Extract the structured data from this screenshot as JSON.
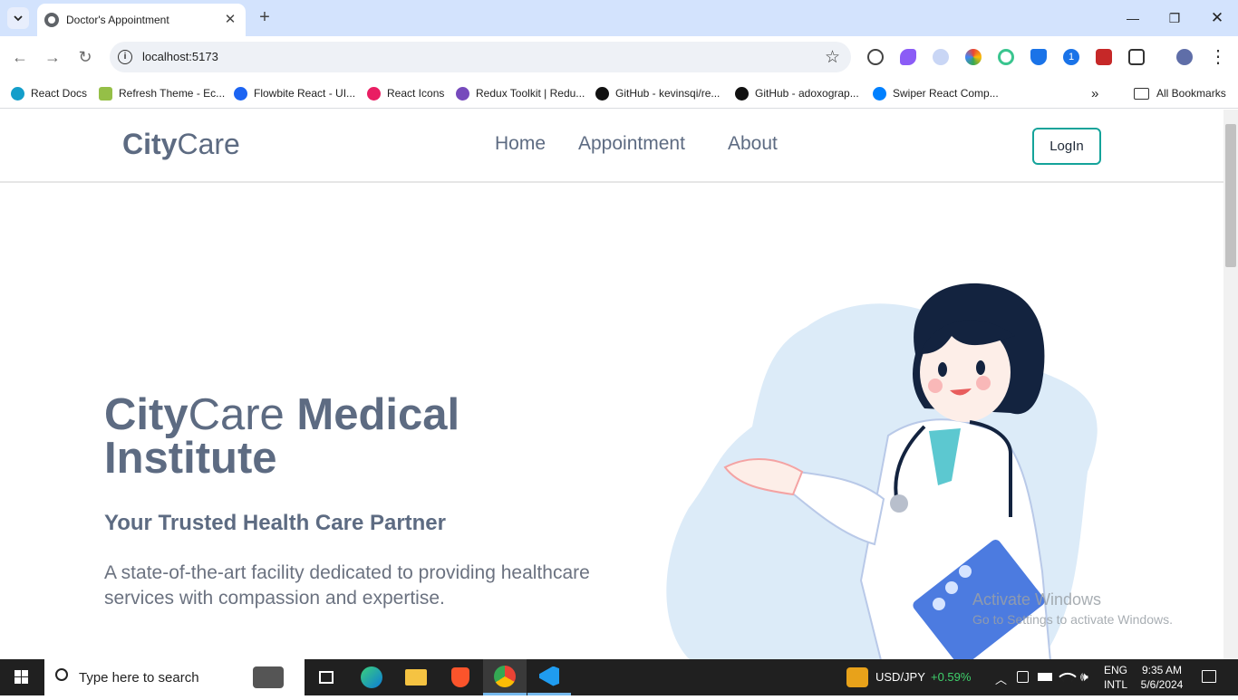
{
  "browser": {
    "tab_title": "Doctor's Appointment",
    "url": "localhost:5173",
    "bookmarks": [
      {
        "label": "React Docs",
        "color": "#149eca"
      },
      {
        "label": "Refresh Theme - Ec...",
        "color": "#95bf47"
      },
      {
        "label": "Flowbite React - UI...",
        "color": "#1c64f2"
      },
      {
        "label": "React Icons",
        "color": "#e91e63"
      },
      {
        "label": "Redux Toolkit | Redu...",
        "color": "#764abc"
      },
      {
        "label": "GitHub - kevinsqi/re...",
        "color": "#111111"
      },
      {
        "label": "GitHub - adoxograp...",
        "color": "#111111"
      },
      {
        "label": "Swiper React Comp...",
        "color": "#0080ff"
      }
    ],
    "all_bookmarks": "All Bookmarks"
  },
  "navbar": {
    "logo_bold": "City",
    "logo_light": "Care",
    "links": [
      "Home",
      "Appointment",
      "About"
    ],
    "login_label": "LogIn"
  },
  "hero": {
    "title_bold": "City",
    "title_light": "Care",
    "title_rest": " Medical Institute",
    "subtitle": "Your Trusted Health Care Partner",
    "description": "A state-of-the-art facility dedicated to providing healthcare services with compassion and expertise."
  },
  "watermark": {
    "title": "Activate Windows",
    "subtitle": "Go to Settings to activate Windows."
  },
  "taskbar": {
    "search_placeholder": "Type here to search",
    "ticker": "USD/JPY",
    "ticker_change": "+0.59%",
    "lang1": "ENG",
    "lang2": "INTL",
    "time": "9:35 AM",
    "date": "5/6/2024"
  },
  "colors": {
    "accent": "#14a39a",
    "text": "#5d6b82",
    "blob": "#dcebf8"
  }
}
